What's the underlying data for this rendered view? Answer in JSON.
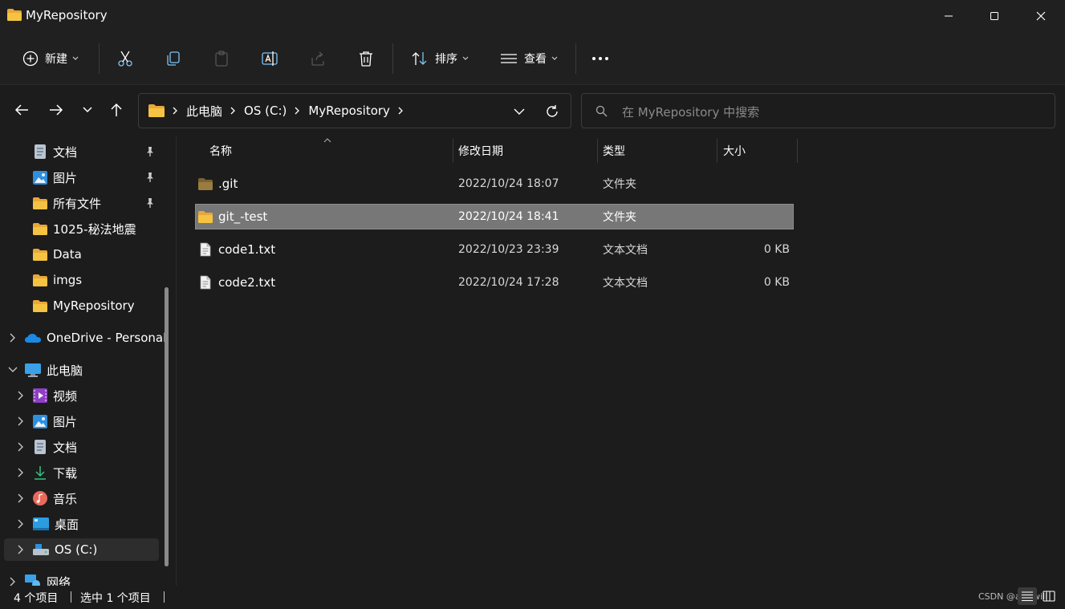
{
  "window": {
    "title": "MyRepository"
  },
  "toolbar": {
    "new_label": "新建",
    "sort_label": "排序",
    "view_label": "查看"
  },
  "breadcrumb": [
    "此电脑",
    "OS (C:)",
    "MyRepository"
  ],
  "search": {
    "placeholder": "在 MyRepository 中搜索"
  },
  "sidebar": {
    "quick_access": [
      {
        "label": "文档",
        "icon": "documents-icon",
        "pinned": true
      },
      {
        "label": "图片",
        "icon": "pictures-icon",
        "pinned": true
      },
      {
        "label": "所有文件",
        "icon": "folder-icon",
        "pinned": true
      },
      {
        "label": "1025-秘法地震",
        "icon": "folder-icon",
        "pinned": false
      },
      {
        "label": "Data",
        "icon": "folder-icon",
        "pinned": false
      },
      {
        "label": "imgs",
        "icon": "folder-icon",
        "pinned": false
      },
      {
        "label": "MyRepository",
        "icon": "folder-icon",
        "pinned": false
      }
    ],
    "onedrive": {
      "label": "OneDrive - Personal",
      "icon": "onedrive-icon"
    },
    "this_pc": {
      "label": "此电脑",
      "icon": "computer-icon"
    },
    "pc_items": [
      {
        "label": "视频",
        "icon": "videos-icon"
      },
      {
        "label": "图片",
        "icon": "pictures-icon"
      },
      {
        "label": "文档",
        "icon": "documents-icon"
      },
      {
        "label": "下载",
        "icon": "downloads-icon"
      },
      {
        "label": "音乐",
        "icon": "music-icon"
      },
      {
        "label": "桌面",
        "icon": "desktop-icon"
      },
      {
        "label": "OS (C:)",
        "icon": "drive-icon"
      }
    ],
    "network": {
      "label": "网络",
      "icon": "network-icon"
    }
  },
  "columns": {
    "name": "名称",
    "modified": "修改日期",
    "type": "类型",
    "size": "大小"
  },
  "files": [
    {
      "name": ".git",
      "modified": "2022/10/24 18:07",
      "type": "文件夹",
      "size": "",
      "kind": "folder-dim"
    },
    {
      "name": "git_-test",
      "modified": "2022/10/24 18:41",
      "type": "文件夹",
      "size": "",
      "kind": "folder"
    },
    {
      "name": "code1.txt",
      "modified": "2022/10/23 23:39",
      "type": "文本文档",
      "size": "0 KB",
      "kind": "file"
    },
    {
      "name": "code2.txt",
      "modified": "2022/10/24 17:28",
      "type": "文本文档",
      "size": "0 KB",
      "kind": "file"
    }
  ],
  "status": {
    "count": "4 个项目",
    "selected": "选中 1 个项目"
  },
  "watermark": "CSDN @ass-will",
  "colors": {
    "background": "#1c1c1c",
    "chrome": "#202020",
    "selected_row": "#777777",
    "folder": "#f5c342",
    "accent": "#4cc2ff"
  }
}
